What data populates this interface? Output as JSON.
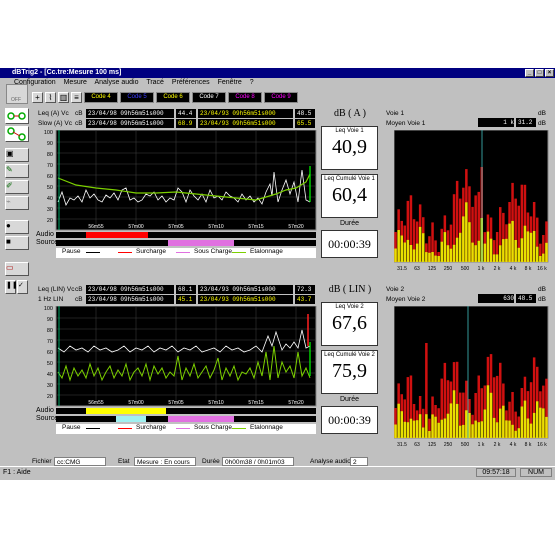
{
  "window": {
    "title": "dBTrig2 - [Cc.tre:Mesure 100 ms]"
  },
  "menu": [
    "Configuration",
    "Mesure",
    "Analyse audio",
    "Tracé",
    "Préférences",
    "Fenêtre",
    "?"
  ],
  "toolbar": {
    "codes": [
      {
        "label": "Code 4",
        "color": "#ffff00"
      },
      {
        "label": "Code 5",
        "color": "#0000ff"
      },
      {
        "label": "Code 6",
        "color": "#ffff00"
      },
      {
        "label": "Code 7",
        "color": "#ffffff"
      },
      {
        "label": "Code 8",
        "color": "#ff00ff"
      },
      {
        "label": "Code 9",
        "color": "#ff00ff"
      }
    ]
  },
  "left_panel": {
    "off_label": "OFF"
  },
  "top_section": {
    "row1": {
      "label": "Leq (A) Vc",
      "unit": "cB",
      "date": "23/04/98 09h56m51s000",
      "value": "44.4",
      "date2": "23/04/93 09h56m51s000",
      "value2": "48.5"
    },
    "row2": {
      "label": "Slow (A) Vc",
      "unit": "cB",
      "date": "23/04/98 09h56m51s000",
      "value": "68.9",
      "date2": "23/04/93 09h56m51s000",
      "value2": "65.5"
    },
    "y_ticks": [
      "100",
      "90",
      "80",
      "70",
      "60",
      "50",
      "40",
      "30",
      "20"
    ],
    "x_ticks": [
      "56m55",
      "57m00",
      "57m05",
      "57m10",
      "57m15",
      "57m20"
    ],
    "audio_label": "Audio",
    "source_label": "Source",
    "legend": [
      "Pause",
      "Surcharge",
      "Sous Charge",
      "Etalonnage"
    ],
    "big_title": "dB ( A )",
    "leq_voie_label": "Leq Voie 1",
    "leq_voie_value": "40,9",
    "leq_cumul_label": "Leq Cumulé Voie 1",
    "leq_cumul_value": "60,4",
    "duree_label": "Durée",
    "duree_value": "00:00:39"
  },
  "bottom_section": {
    "row1": {
      "label": "Leq (LIN) Vc",
      "unit": "cB",
      "date": "23/04/98 09h56m51s000",
      "value": "68.1",
      "date2": "23/04/93 09h56m51s000",
      "value2": "72.3"
    },
    "row2": {
      "label": "1 Hz LIN",
      "unit": "cB",
      "date": "23/04/98 09h56m51s000",
      "value": "45.1",
      "date2": "23/04/93 09h56m51s000",
      "value2": "43.7"
    },
    "y_ticks": [
      "100",
      "90",
      "80",
      "70",
      "60",
      "50",
      "40",
      "30",
      "20"
    ],
    "x_ticks": [
      "56m55",
      "57m00",
      "57m05",
      "57m10",
      "57m15",
      "57m20"
    ],
    "audio_label": "Audio",
    "source_label": "Source",
    "legend": [
      "Pause",
      "Surcharge",
      "Sous Charge",
      "Etalonnage"
    ],
    "big_title": "dB ( LIN )",
    "leq_voie_label": "Leq Voie 2",
    "leq_voie_value": "67,6",
    "leq_cumul_label": "Leq Cumulé Voie 2",
    "leq_cumul_value": "75,9",
    "duree_label": "Durée",
    "duree_value": "00:00:39"
  },
  "spectrum1": {
    "voie_label": "Voie 1",
    "voie_val_a": "1 k",
    "voie_val_b": "31.2",
    "moyen_label": "Moyen Voie 1",
    "moyen_val_a": "",
    "moyen_val_b": "",
    "unit": "dB",
    "x_ticks": [
      "31.5",
      "63",
      "125",
      "250",
      "500",
      "1 k",
      "2 k",
      "4 k",
      "8 k",
      "16 k"
    ]
  },
  "spectrum2": {
    "voie_label": "Voie 2",
    "voie_val_a": "630",
    "voie_val_b": "48.5",
    "moyen_label": "Moyen Voie 2",
    "moyen_val_a": "",
    "moyen_val_b": "",
    "unit": "dB",
    "x_ticks": [
      "31.5",
      "63",
      "125",
      "250",
      "500",
      "1 k",
      "2 k",
      "4 k",
      "8 k",
      "16 k"
    ]
  },
  "footer": {
    "fichier_label": "Fichier",
    "fichier_value": "cc:CMG",
    "etat_label": "Etat",
    "etat_value": "Mesure : En cours",
    "duree_label": "Durée",
    "duree_value": "0h00m38 / 0h01m03",
    "analyse_label": "Analyse audio",
    "analyse_value": "2"
  },
  "statusbar": {
    "help": "F1 : Aide",
    "time": "09:57:18",
    "num": "NUM"
  }
}
